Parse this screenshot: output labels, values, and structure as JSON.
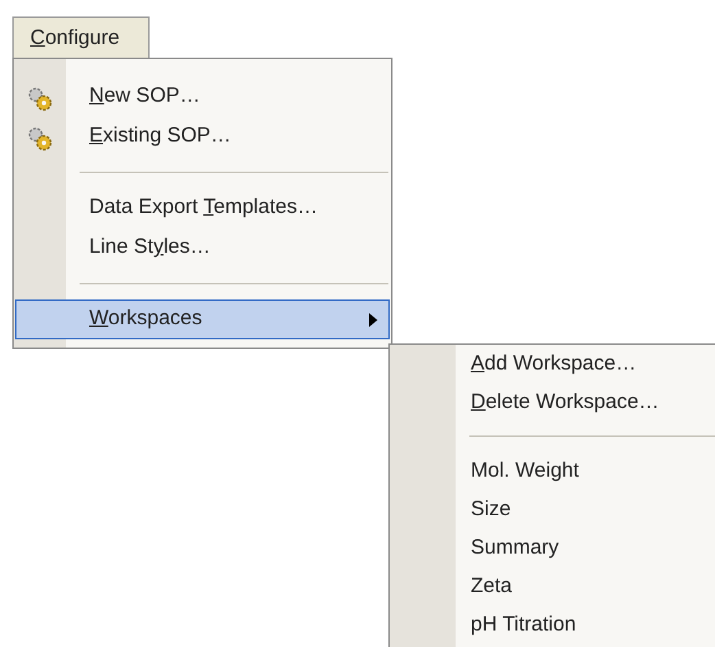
{
  "menu_title": {
    "label_parts": {
      "key": "C",
      "after": "onfigure"
    }
  },
  "menu": [
    {
      "kind": "icon-item",
      "label_parts": {
        "key": "N",
        "after": "ew SOP…"
      },
      "selected": false
    },
    {
      "kind": "icon-item",
      "label_parts": {
        "key": "E",
        "after": "xisting SOP…"
      },
      "selected": false
    },
    {
      "kind": "separator"
    },
    {
      "kind": "item",
      "label_parts": {
        "before": "Data Export ",
        "key": "T",
        "after": "emplates…"
      },
      "selected": false
    },
    {
      "kind": "item",
      "label_parts": {
        "before": "Line St",
        "key": "y",
        "after": "les…"
      },
      "selected": false
    },
    {
      "kind": "separator"
    },
    {
      "kind": "submenu",
      "label_parts": {
        "key": "W",
        "after": "orkspaces"
      },
      "selected": true
    }
  ],
  "submenu": [
    {
      "kind": "item",
      "label_parts": {
        "key": "A",
        "after": "dd Workspace…"
      },
      "selected": false
    },
    {
      "kind": "item",
      "label_parts": {
        "key": "D",
        "after": "elete Workspace…"
      },
      "selected": false
    },
    {
      "kind": "separator"
    },
    {
      "kind": "item",
      "label": "Mol. Weight",
      "selected": false
    },
    {
      "kind": "item",
      "label": "Size",
      "selected": false
    },
    {
      "kind": "item",
      "label": "Summary",
      "selected": false
    },
    {
      "kind": "item",
      "label": "Zeta",
      "selected": false
    },
    {
      "kind": "item",
      "label": "pH Titration",
      "selected": false
    }
  ]
}
